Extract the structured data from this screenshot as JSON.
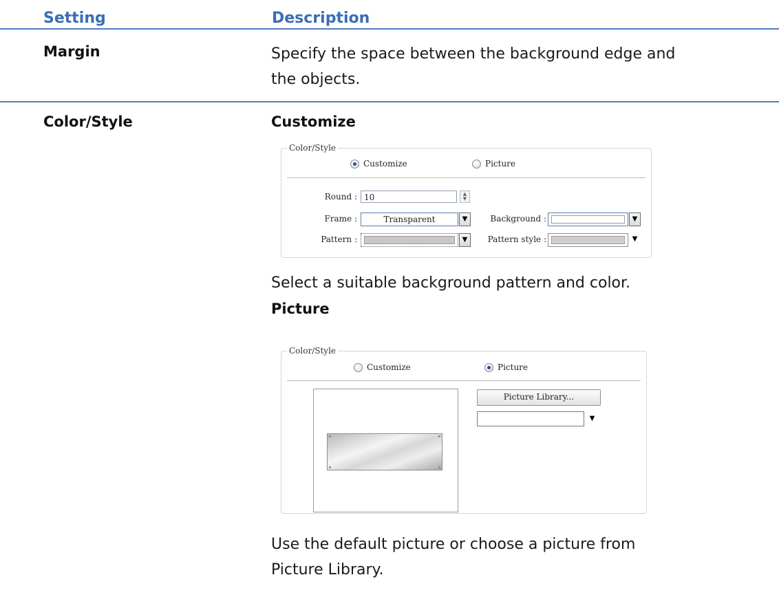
{
  "header": {
    "col1": "Setting",
    "col2": "Description"
  },
  "margin_row": {
    "label": "Margin",
    "desc_line1": "Specify the space between the background edge and",
    "desc_line2": "the objects."
  },
  "color_row": {
    "label": "Color/Style",
    "customize_heading": "Customize",
    "customize_text": "Select a suitable background pattern and color.",
    "picture_heading": "Picture",
    "picture_text_line1": "Use the default picture or choose a picture from",
    "picture_text_line2": "Picture Library."
  },
  "dialog_customize": {
    "legend": "Color/Style",
    "radio_customize": "Customize",
    "radio_picture": "Picture",
    "selected": "Customize",
    "round_label": "Round :",
    "round_value": "10",
    "frame_label": "Frame :",
    "frame_value": "Transparent",
    "background_label": "Background :",
    "pattern_label": "Pattern :",
    "pattern_style_label": "Pattern style :"
  },
  "dialog_picture": {
    "legend": "Color/Style",
    "radio_customize": "Customize",
    "radio_picture": "Picture",
    "selected": "Picture",
    "library_button": "Picture Library..."
  },
  "colors": {
    "accent": "#3a6db5",
    "rule": "#4c7cc0"
  },
  "icons": [
    "radio-icon",
    "spin-up-icon",
    "spin-down-icon",
    "dropdown-arrow-icon"
  ]
}
